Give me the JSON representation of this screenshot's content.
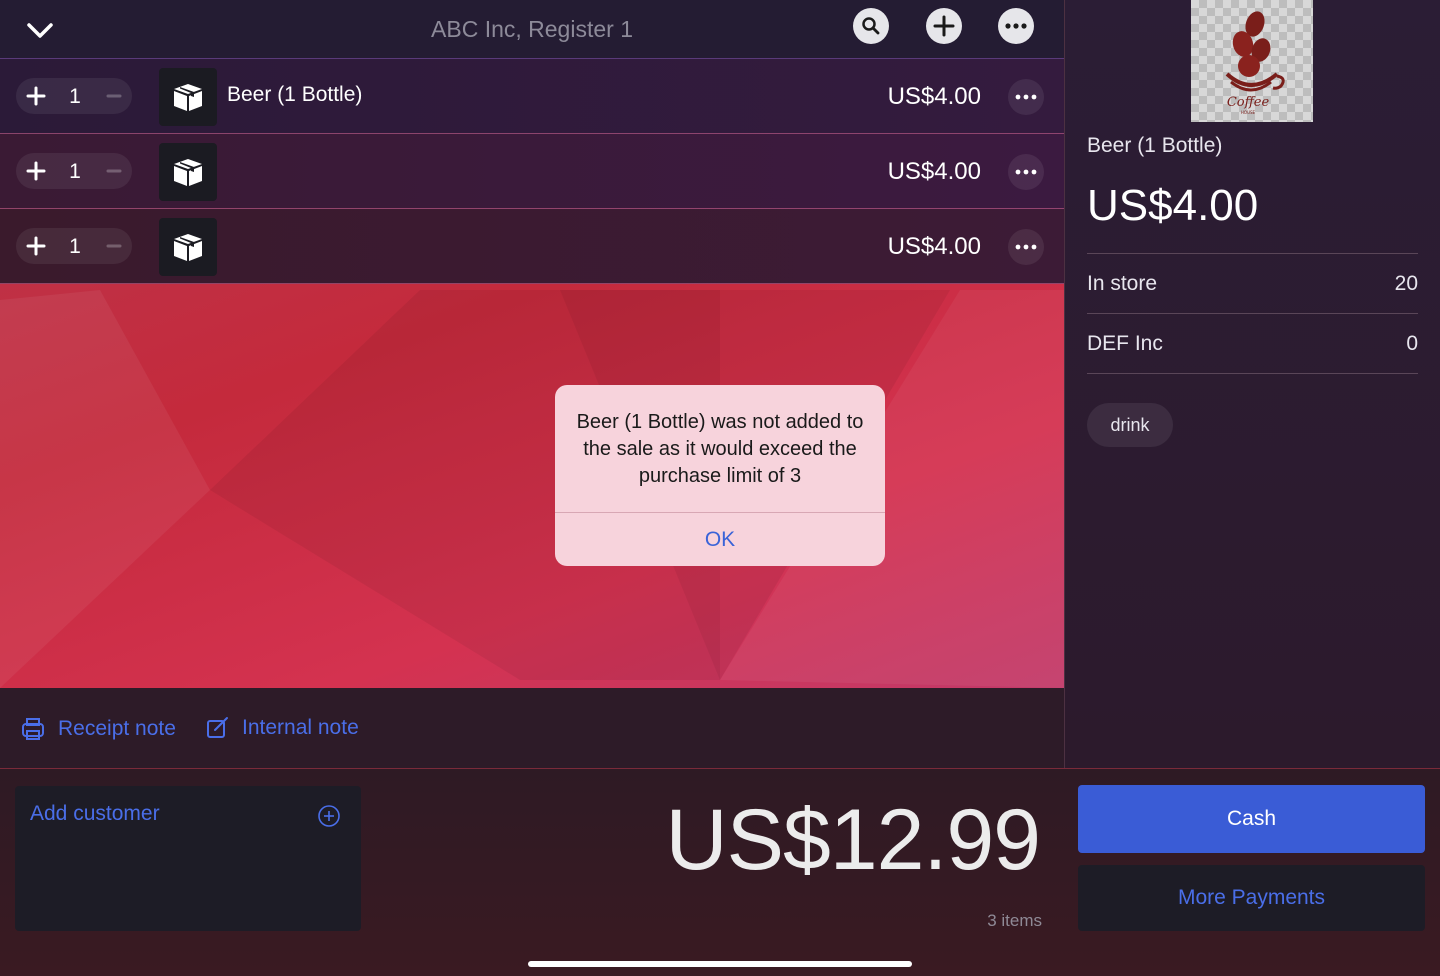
{
  "header": {
    "title": "ABC Inc, Register 1",
    "icons": [
      "chevron-down-icon",
      "search-icon",
      "plus-icon",
      "ellipsis-icon"
    ]
  },
  "cart": {
    "rows": [
      {
        "qty": "1",
        "name": "Beer (1 Bottle)",
        "price": "US$4.00"
      },
      {
        "qty": "1",
        "name": "",
        "price": "US$4.00"
      },
      {
        "qty": "1",
        "name": "",
        "price": "US$4.00"
      }
    ]
  },
  "notes": {
    "receipt": "Receipt note",
    "internal": "Internal note"
  },
  "detail": {
    "image_text": "Coffee",
    "image_subtext": "HOUSE",
    "name": "Beer (1 Bottle)",
    "price": "US$4.00",
    "stock": [
      {
        "label": "In store",
        "value": "20"
      },
      {
        "label": "DEF Inc",
        "value": "0"
      }
    ],
    "tag": "drink"
  },
  "footer": {
    "add_customer": "Add customer",
    "total": "US$12.99",
    "item_count": "3 items",
    "cash": "Cash",
    "more_payments": "More Payments"
  },
  "alert": {
    "message": "Beer (1 Bottle) was not added to the sale as it would exceed the purchase limit of 3",
    "ok": "OK"
  },
  "colors": {
    "accent": "#3a5cd6",
    "link": "#4a6ee8",
    "alert_bg": "#f7d3dc"
  }
}
